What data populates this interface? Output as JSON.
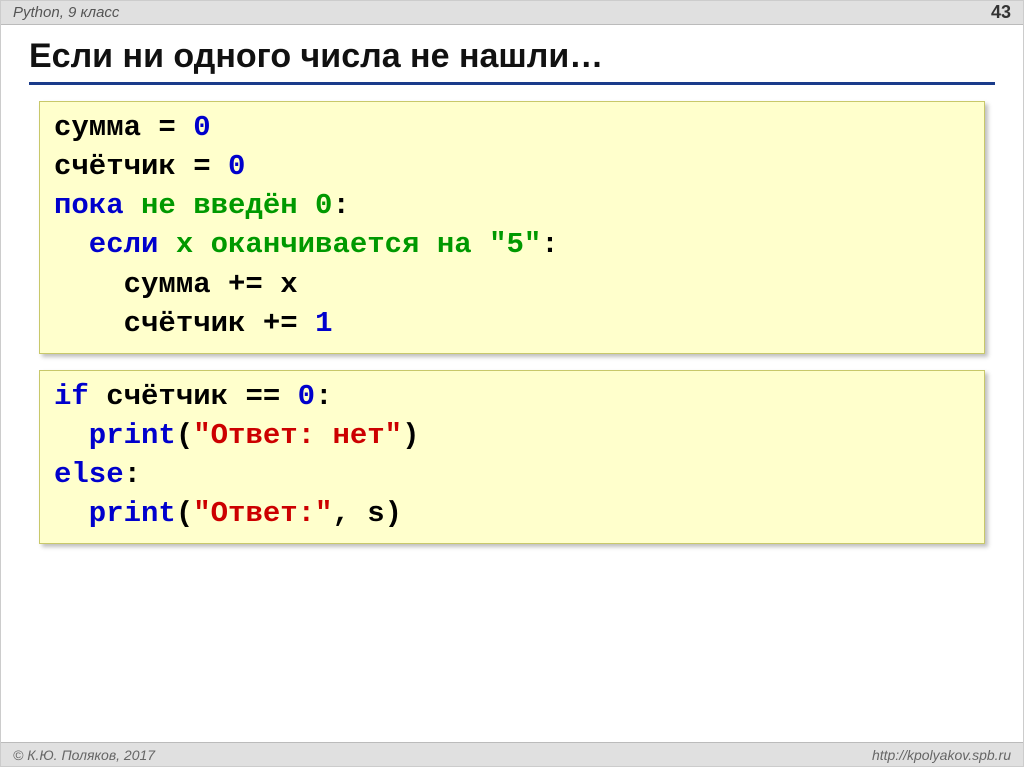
{
  "header": {
    "course": "Python, 9 класс",
    "page": "43"
  },
  "title": "Если ни одного числа не нашли…",
  "code1": {
    "l1a": "сумма",
    "l1b": " = ",
    "l1c": "0",
    "l2a": "счётчик",
    "l2b": " = ",
    "l2c": "0",
    "l3a": "пока",
    "l3b": " не введён 0",
    "l3c": ":",
    "l4a": "  если",
    "l4b": " x оканчивается на \"5\"",
    "l4c": ":",
    "l5": "    сумма += x",
    "l6a": "    счётчик",
    "l6b": " += ",
    "l6c": "1"
  },
  "code2": {
    "l1a": "if",
    "l1b": " счётчик",
    "l1c": " == ",
    "l1d": "0",
    "l1e": ":",
    "l2a": "  print",
    "l2b": "(",
    "l2c": "\"Ответ: нет\"",
    "l2d": ")",
    "l3a": "else",
    "l3b": ":",
    "l4a": "  print",
    "l4b": "(",
    "l4c": "\"Ответ:\"",
    "l4d": ", s)"
  },
  "footer": {
    "copyright": "© К.Ю. Поляков, 2017",
    "url": "http://kpolyakov.spb.ru"
  }
}
